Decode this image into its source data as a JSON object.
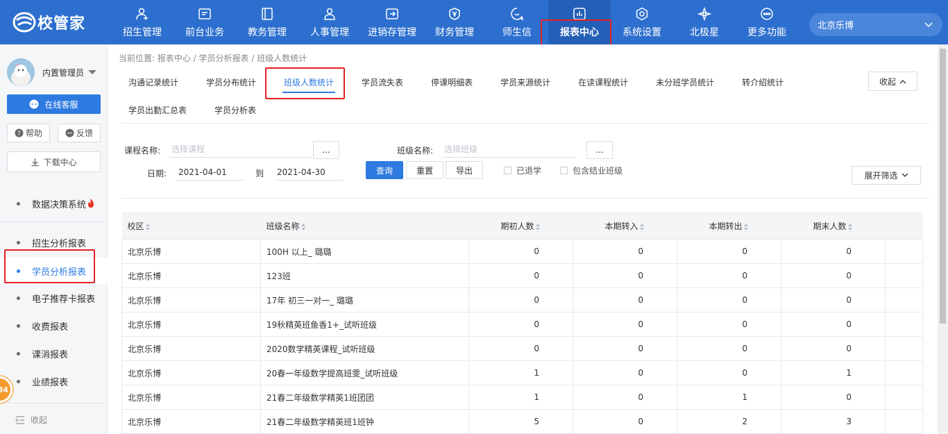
{
  "app": {
    "logo_text": "校管家"
  },
  "colors": {
    "primary": "#2d6fce",
    "accent": "#2d7ae0",
    "highlight": "#e62020",
    "badge": "#f39a2b"
  },
  "nav": {
    "items": [
      {
        "label": "招生管理",
        "icon": "user-plus-icon"
      },
      {
        "label": "前台业务",
        "icon": "monitor-icon"
      },
      {
        "label": "教务管理",
        "icon": "book-icon"
      },
      {
        "label": "人事管理",
        "icon": "person-icon"
      },
      {
        "label": "进销存管理",
        "icon": "inventory-icon"
      },
      {
        "label": "财务管理",
        "icon": "yen-shield-icon"
      },
      {
        "label": "师生信",
        "icon": "chat-bubble-icon"
      },
      {
        "label": "报表中心",
        "icon": "report-chart-icon",
        "active": true
      },
      {
        "label": "系统设置",
        "icon": "gear-icon"
      },
      {
        "label": "北极星",
        "icon": "star-icon"
      },
      {
        "label": "更多功能",
        "icon": "more-icon"
      }
    ],
    "campus": "北京乐博"
  },
  "sidebar": {
    "user_name": "内置管理员",
    "service_label": "在线客服",
    "help_label": "帮助",
    "feedback_label": "反馈",
    "download_label": "下载中心",
    "decision_label": "数据决策系统",
    "items": [
      {
        "label": "招生分析报表"
      },
      {
        "label": "学员分析报表",
        "active": true
      },
      {
        "label": "电子推荐卡报表"
      },
      {
        "label": "收费报表"
      },
      {
        "label": "课消报表"
      },
      {
        "label": "业绩报表"
      }
    ],
    "collapse_label": "收起",
    "badge_text": "84"
  },
  "main": {
    "breadcrumb": "当前位置: 报表中心 / 学员分析报表 / 班级人数统计",
    "tabs_row1": [
      "沟通记录统计",
      "学员分布统计",
      "班级人数统计",
      "学员流失表",
      "停课明细表",
      "学员来源统计",
      "在读课程统计",
      "未分班学员统计",
      "转介绍统计"
    ],
    "tabs_row2": [
      "学员出勤汇总表",
      "学员分析表"
    ],
    "active_tab": "班级人数统计",
    "collapse_label": "收起 ^"
  },
  "filters": {
    "course_label": "课程名称:",
    "course_placeholder": "选择课程",
    "class_label": "班级名称:",
    "class_placeholder": "选择班级",
    "dots": "...",
    "date_label": "日期:",
    "date_from": "2021-04-01",
    "to_label": "到",
    "date_to": "2021-04-30",
    "query": "查询",
    "reset": "重置",
    "export": "导出",
    "withdrawn": "已退学",
    "include_finished": "包含结业班级",
    "expand": "展开筛选"
  },
  "table": {
    "headers": [
      "校区",
      "班级名称",
      "期初人数",
      "本期转入",
      "本期转出",
      "期末人数"
    ],
    "rows": [
      [
        "北京乐博",
        "100H 以上_ 璐璐",
        "0",
        "0",
        "0",
        "0"
      ],
      [
        "北京乐博",
        "123班",
        "0",
        "0",
        "0",
        "0"
      ],
      [
        "北京乐博",
        "17年 初三一对一_ 璐璐",
        "0",
        "0",
        "0",
        "0"
      ],
      [
        "北京乐博",
        "19秋精英班鱼香1+_试听班级",
        "0",
        "0",
        "0",
        "0"
      ],
      [
        "北京乐博",
        "2020数学精英课程_试听班级",
        "0",
        "0",
        "0",
        "0"
      ],
      [
        "北京乐博",
        "20春一年级数学提高班雯_试听班级",
        "1",
        "0",
        "0",
        "1"
      ],
      [
        "北京乐博",
        "21春二年级数学精英1班团团",
        "1",
        "0",
        "1",
        "0"
      ],
      [
        "北京乐博",
        "21春二年级数学精英班1班钟",
        "5",
        "0",
        "2",
        "3"
      ]
    ]
  }
}
